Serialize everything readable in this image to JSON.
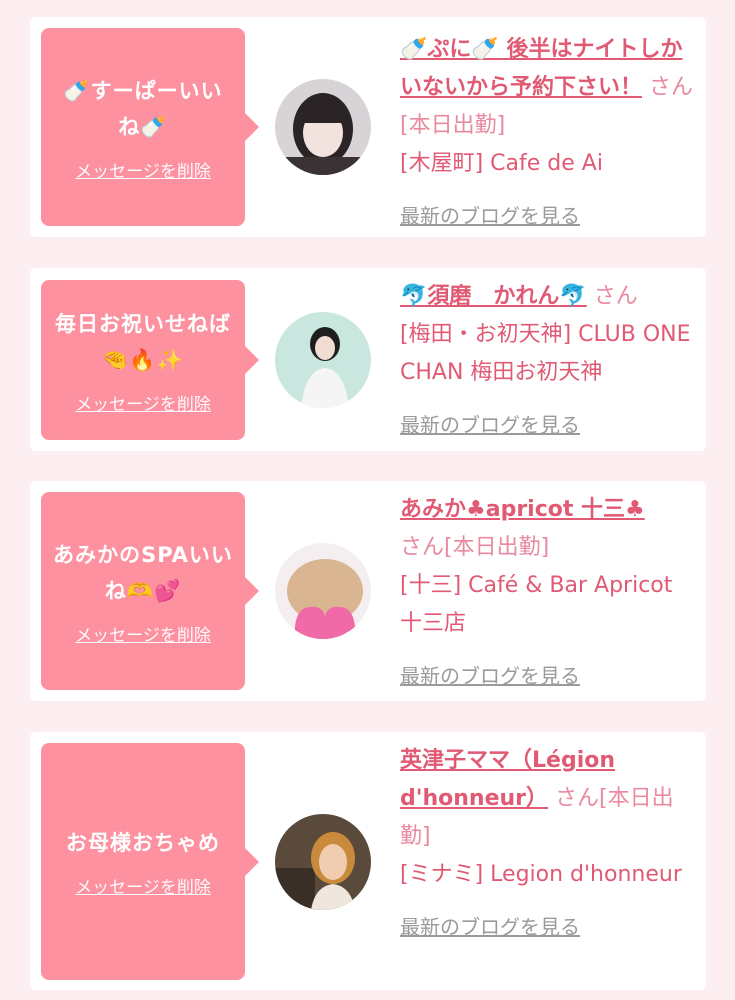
{
  "items": [
    {
      "message_a": "🍼",
      "message_b": "すーぱーいい",
      "message_c": "ね",
      "message_d": "🍼",
      "delete_label": "メッセージを削除",
      "cast_name_a": "🍼ぷに🍼",
      "cast_name_b": " 後半はナイトしかいないから予約下さい！",
      "san": "さん[本日出勤]",
      "shop": "[木屋町] Cafe de Ai",
      "blog_label": "最新のブログを見る"
    },
    {
      "message_a": "毎日お祝いせねば",
      "message_b": "🤏🔥✨",
      "delete_label": "メッセージを削除",
      "cast_name": "🐬須磨　かれん🐬",
      "san": "さん",
      "shop": "[梅田・お初天神] CLUB ONE CHAN 梅田お初天神",
      "blog_label": "最新のブログを見る"
    },
    {
      "message_a": "あみかのSPAいい",
      "message_b": "ね🫶💕",
      "delete_label": "メッセージを削除",
      "cast_name": "あみか♣apricot 十三♣",
      "san": "さん[本日出勤]",
      "shop": "[十三] Café & Bar Apricot 十三店",
      "blog_label": "最新のブログを見る"
    },
    {
      "message_a": "お母様おちゃめ",
      "delete_label": "メッセージを削除",
      "cast_name": "英津子ママ（Légion d'honneur）",
      "san": "さん[本日出勤]",
      "shop": "[ミナミ] Legion d'honneur",
      "blog_label": "最新のブログを見る"
    }
  ],
  "colors": {
    "page_bg": "#fdeef2",
    "bubble_bg": "#fd919f",
    "accent_text": "#e15a74",
    "muted_link": "#9a9a9a"
  }
}
